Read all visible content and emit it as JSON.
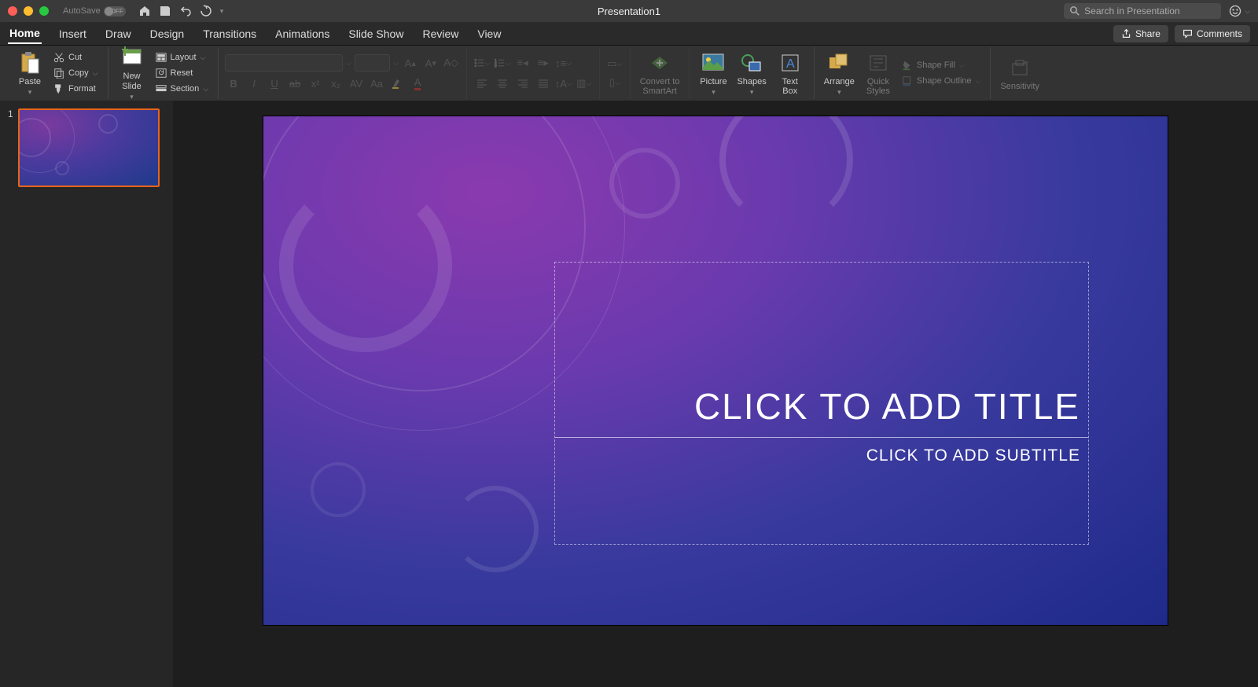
{
  "titlebar": {
    "autosave_label": "AutoSave",
    "autosave_state": "OFF",
    "title": "Presentation1",
    "search_placeholder": "Search in Presentation"
  },
  "tabs": {
    "items": [
      "Home",
      "Insert",
      "Draw",
      "Design",
      "Transitions",
      "Animations",
      "Slide Show",
      "Review",
      "View"
    ],
    "active": "Home",
    "share": "Share",
    "comments": "Comments"
  },
  "ribbon": {
    "clipboard": {
      "paste": "Paste",
      "cut": "Cut",
      "copy": "Copy",
      "format": "Format"
    },
    "slides": {
      "new_slide": "New\nSlide",
      "layout": "Layout",
      "reset": "Reset",
      "section": "Section"
    },
    "smartart": "Convert to\nSmartArt",
    "insert": {
      "picture": "Picture",
      "shapes": "Shapes",
      "textbox": "Text\nBox"
    },
    "arrange": "Arrange",
    "quickstyles": "Quick\nStyles",
    "shapefill": "Shape Fill",
    "shapeoutline": "Shape Outline",
    "sensitivity": "Sensitivity"
  },
  "thumbnails": {
    "slides": [
      {
        "num": "1"
      }
    ]
  },
  "slide": {
    "title_placeholder": "CLICK TO ADD TITLE",
    "subtitle_placeholder": "CLICK TO ADD SUBTITLE"
  }
}
